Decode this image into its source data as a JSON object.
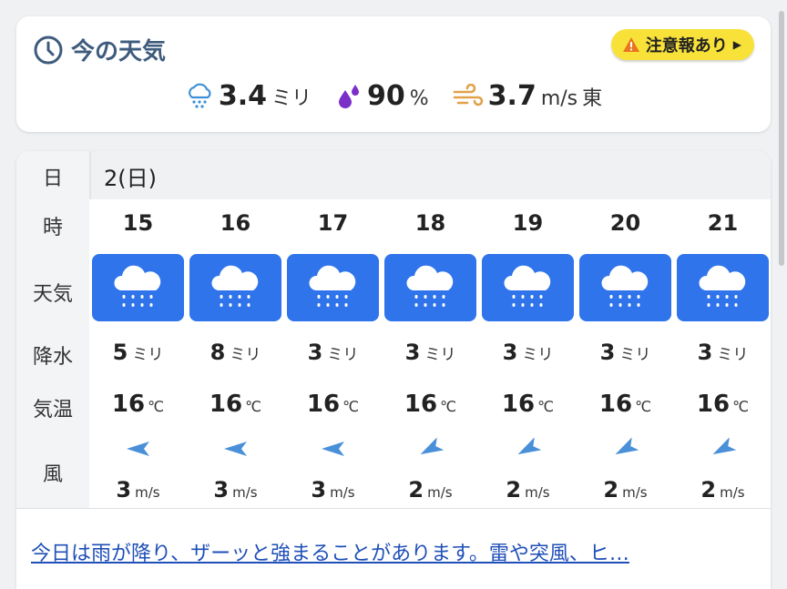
{
  "now": {
    "title": "今の天気",
    "alert": "注意報あり",
    "precip": {
      "value": "3.4",
      "unit": "ミリ"
    },
    "humidity": {
      "value": "90",
      "unit": "%"
    },
    "wind": {
      "value": "3.7",
      "unit": "m/s",
      "dir": "東"
    }
  },
  "labels": {
    "date": "日",
    "hour": "時",
    "weather": "天気",
    "precip": "降水",
    "temp": "気温",
    "wind": "風"
  },
  "date": "2(日)",
  "hours": [
    {
      "hour": "15",
      "precip": "5",
      "precip_unit": "ミリ",
      "temp": "16",
      "temp_unit": "℃",
      "wind": "3",
      "wind_unit": "m/s",
      "wind_dir": "east",
      "weather_icon": "rain-icon"
    },
    {
      "hour": "16",
      "precip": "8",
      "precip_unit": "ミリ",
      "temp": "16",
      "temp_unit": "℃",
      "wind": "3",
      "wind_unit": "m/s",
      "wind_dir": "east",
      "weather_icon": "rain-icon"
    },
    {
      "hour": "17",
      "precip": "3",
      "precip_unit": "ミリ",
      "temp": "16",
      "temp_unit": "℃",
      "wind": "3",
      "wind_unit": "m/s",
      "wind_dir": "east",
      "weather_icon": "rain-icon"
    },
    {
      "hour": "18",
      "precip": "3",
      "precip_unit": "ミリ",
      "temp": "16",
      "temp_unit": "℃",
      "wind": "2",
      "wind_unit": "m/s",
      "wind_dir": "northeast",
      "weather_icon": "rain-icon"
    },
    {
      "hour": "19",
      "precip": "3",
      "precip_unit": "ミリ",
      "temp": "16",
      "temp_unit": "℃",
      "wind": "2",
      "wind_unit": "m/s",
      "wind_dir": "northeast",
      "weather_icon": "rain-icon"
    },
    {
      "hour": "20",
      "precip": "3",
      "precip_unit": "ミリ",
      "temp": "16",
      "temp_unit": "℃",
      "wind": "2",
      "wind_unit": "m/s",
      "wind_dir": "northeast",
      "weather_icon": "rain-icon"
    },
    {
      "hour": "21",
      "precip": "3",
      "precip_unit": "ミリ",
      "temp": "16",
      "temp_unit": "℃",
      "wind": "2",
      "wind_unit": "m/s",
      "wind_dir": "northeast",
      "weather_icon": "rain-icon"
    }
  ],
  "comment": "今日は雨が降り、ザーッと強まることがあります。雷や突風、ヒ…",
  "colors": {
    "accent": "#3e5b7d",
    "tile": "#2f74ea",
    "alert": "#f8e23a",
    "link": "#1f4fb8",
    "humidity": "#7b2fc9",
    "wind_icon": "#e0a24a"
  }
}
